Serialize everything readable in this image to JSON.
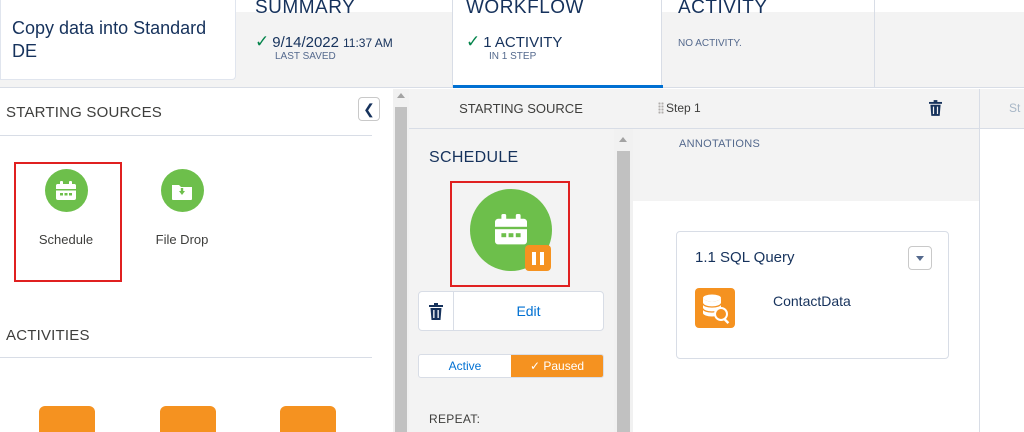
{
  "header": {
    "name": "Copy data into Standard DE",
    "summary": {
      "label": "SUMMARY",
      "date": "9/14/2022",
      "time": "11:37 AM",
      "sub": "LAST SAVED"
    },
    "workflow": {
      "label": "WORKFLOW",
      "main": "1 ACTIVITY",
      "sub": "IN 1 STEP"
    },
    "activity": {
      "label": "ACTIVITY",
      "sub": "NO ACTIVITY."
    }
  },
  "left_panel": {
    "starting_sources_title": "STARTING SOURCES",
    "sources": [
      {
        "label": "Schedule",
        "icon": "calendar-icon",
        "selected": true
      },
      {
        "label": "File Drop",
        "icon": "folder-download-icon",
        "selected": false
      }
    ],
    "activities_title": "ACTIVITIES"
  },
  "starting_source": {
    "column_title": "STARTING SOURCE",
    "title": "SCHEDULE",
    "edit_label": "Edit",
    "toggle": {
      "active": "Active",
      "paused": "Paused",
      "selected": "Paused"
    },
    "repeat_label": "REPEAT:"
  },
  "step": {
    "title": "Step 1",
    "next_title": "St",
    "annotations_label": "ANNOTATIONS",
    "activity": {
      "title": "1.1 SQL Query",
      "name": "ContactData",
      "icon": "sql-query-icon"
    }
  },
  "colors": {
    "green": "#6dbf4b",
    "orange": "#f59220",
    "blue": "#0070d2",
    "red": "#e02020"
  }
}
